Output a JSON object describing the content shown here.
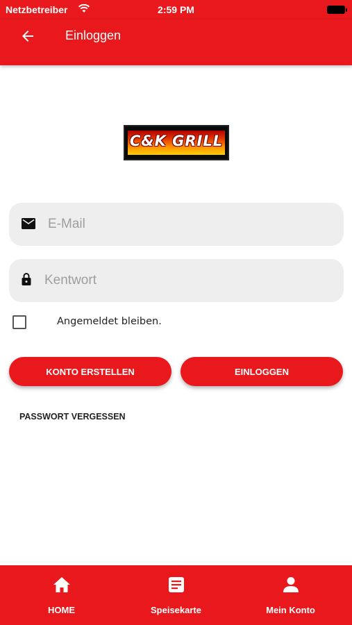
{
  "status_bar": {
    "carrier": "Netzbetreiber",
    "time": "2:59 PM"
  },
  "app_bar": {
    "title": "Einloggen"
  },
  "logo": {
    "text": "C&K GRILL"
  },
  "form": {
    "email_placeholder": "E-Mail",
    "password_placeholder": "Kentwort",
    "remember_label": "Angemeldet bleiben.",
    "create_account_label": "KONTO ERSTELLEN",
    "login_label": "EINLOGGEN",
    "forgot_password_label": "PASSWORT VERGESSEN"
  },
  "bottom_nav": {
    "items": [
      {
        "label": "HOME",
        "icon": "home-icon"
      },
      {
        "label": "Speisekarte",
        "icon": "menu-list-icon"
      },
      {
        "label": "Mein Konto",
        "icon": "person-icon"
      }
    ]
  },
  "colors": {
    "primary": "#e8181c",
    "field_background": "#eeeeee"
  }
}
